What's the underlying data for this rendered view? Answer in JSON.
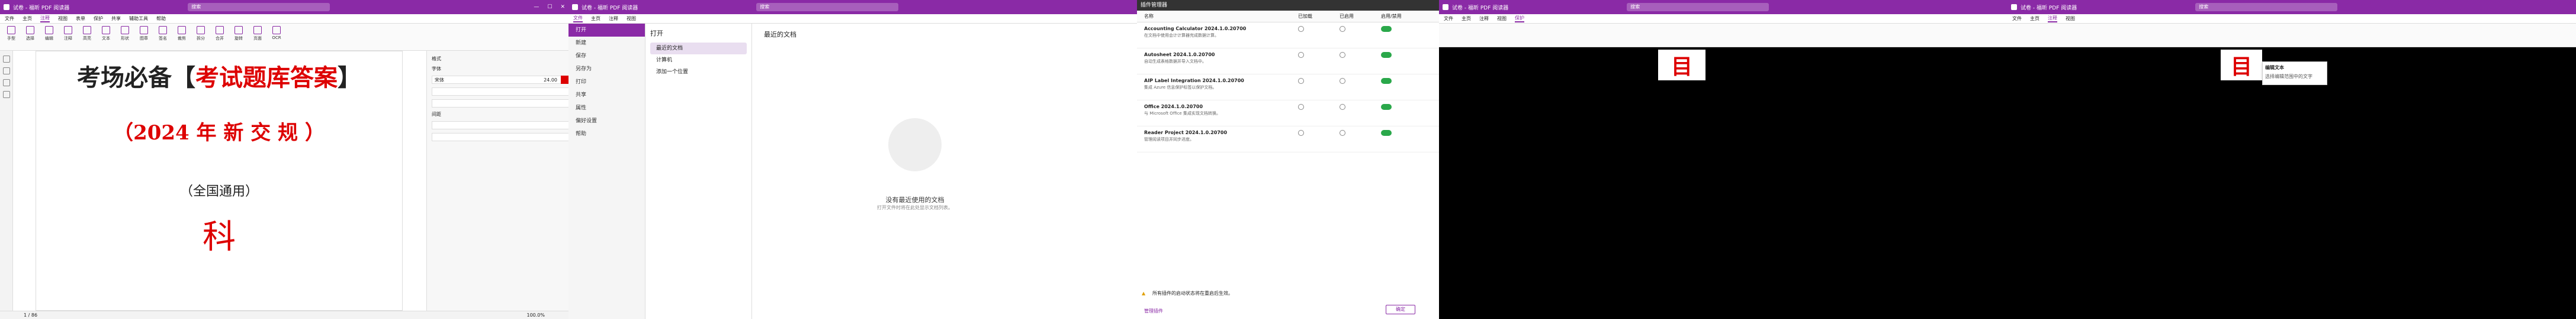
{
  "app": {
    "title": "试卷 - 福昕 PDF 阅读器",
    "search_placeholder": "搜索"
  },
  "colors": {
    "brand": "#8a2aa6",
    "accent_red": "#d00000",
    "toggle_on": "#2aa84a"
  },
  "menus": [
    "文件",
    "主页",
    "注释",
    "视图",
    "表单",
    "保护",
    "共享",
    "辅助工具",
    "帮助"
  ],
  "ribbon_items": [
    "手型",
    "选择",
    "编辑",
    "注释",
    "高亮",
    "文本",
    "形状",
    "图章",
    "签名",
    "裁剪",
    "拆分",
    "合并",
    "旋转",
    "页面",
    "OCR"
  ],
  "document": {
    "heading_black": "考场必备【",
    "heading_red": "考试题库答案",
    "heading_end": "】",
    "year_line": "（2024 年 新 交 规 ）",
    "national": "（全国通用）",
    "subject": "科"
  },
  "properties": {
    "title": "格式",
    "font_label": "字体",
    "font_value": "宋体",
    "size_value": "24.00",
    "spacing_label": "间距"
  },
  "status": {
    "page": "1 / 86",
    "zoom": "100.0%"
  },
  "panel2": {
    "nav": [
      "打开",
      "新建",
      "保存",
      "另存为",
      "打印",
      "共享",
      "属性",
      "偏好设置",
      "帮助"
    ],
    "nav_selected": "打开",
    "mid_title": "打开",
    "mid": [
      "最近的文档",
      "计算机",
      "添加一个位置"
    ],
    "mid_selected": "最近的文档",
    "main_title": "最近的文档",
    "empty_title": "没有最近使用的文档",
    "empty_sub": "打开文件时将在此处显示文档列表。"
  },
  "plugins": {
    "window_title": "插件管理器",
    "headers": [
      "名称",
      "已加载",
      "已启用",
      "启用/禁用"
    ],
    "rows": [
      {
        "name": "Accounting Calculator 2024.1.0.20700",
        "desc": "在文档中使用会计计算器完成数据计算。"
      },
      {
        "name": "Autosheet 2024.1.0.20700",
        "desc": "自动生成表格数据并导入文档中。"
      },
      {
        "name": "AIP Label Integration 2024.1.0.20700",
        "desc": "集成 Azure 信息保护标签以保护文档。"
      },
      {
        "name": "Office 2024.1.0.20700",
        "desc": "与 Microsoft Office 集成实现文档转换。"
      },
      {
        "name": "Reader Project 2024.1.0.20700",
        "desc": "管理阅读项目并同步进度。"
      }
    ],
    "warning": "所有插件的启动状态将在重启后生效。",
    "footer_link": "管理插件",
    "ok": "确定"
  },
  "panel4": {
    "title": "试卷 - 福昕 PDF 阅读器",
    "red_glyph": "目"
  },
  "panel5": {
    "title": "试卷 - 福昕 PDF 阅读器",
    "red_glyph": "目",
    "popup_title": "编辑文本",
    "popup_sub": "选择编辑范围中的文字"
  }
}
